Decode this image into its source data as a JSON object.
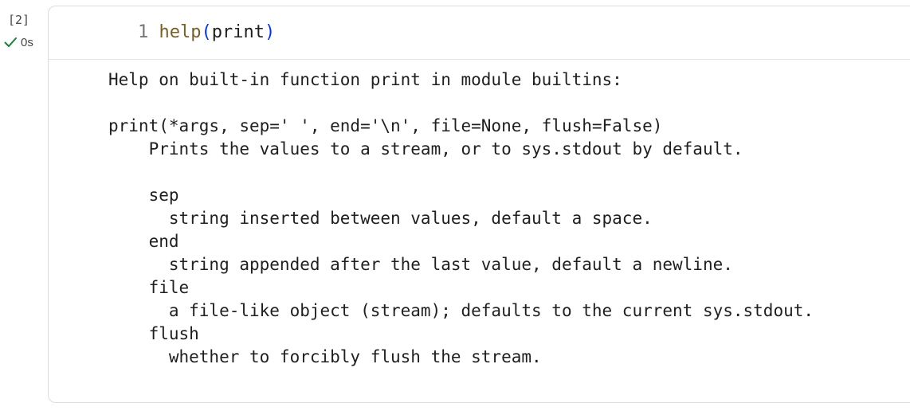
{
  "cell": {
    "execution_count": "[2]",
    "status_icon": "check-icon",
    "status_color": "#188038",
    "exec_time": "0s",
    "code": {
      "line_number": "1",
      "function_name": "help",
      "open_paren": "(",
      "argument": "print",
      "close_paren": ")"
    },
    "output_lines": [
      "Help on built-in function print in module builtins:",
      "",
      "print(*args, sep=' ', end='\\n', file=None, flush=False)",
      "    Prints the values to a stream, or to sys.stdout by default.",
      "",
      "    sep",
      "      string inserted between values, default a space.",
      "    end",
      "      string appended after the last value, default a newline.",
      "    file",
      "      a file-like object (stream); defaults to the current sys.stdout.",
      "    flush",
      "      whether to forcibly flush the stream."
    ]
  }
}
